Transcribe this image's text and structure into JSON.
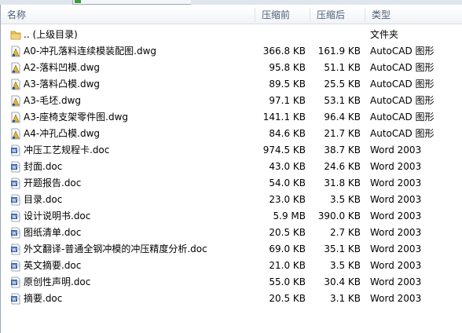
{
  "columns": {
    "name": "名称",
    "original_size": "压缩前",
    "compressed_size": "压缩后",
    "type": "类型"
  },
  "files": [
    {
      "icon": "folder-icon",
      "name": ".. (上级目录)",
      "original": "",
      "compressed": "",
      "type": "文件夹"
    },
    {
      "icon": "autocad-file-icon",
      "name": "A0-冲孔落料连续模装配图.dwg",
      "original": "366.8 KB",
      "compressed": "161.9 KB",
      "type": "AutoCAD 图形"
    },
    {
      "icon": "autocad-file-icon",
      "name": "A2-落料凹模.dwg",
      "original": "95.8 KB",
      "compressed": "51.1 KB",
      "type": "AutoCAD 图形"
    },
    {
      "icon": "autocad-file-icon",
      "name": "A3-落料凸模.dwg",
      "original": "89.5 KB",
      "compressed": "25.5 KB",
      "type": "AutoCAD 图形"
    },
    {
      "icon": "autocad-file-icon",
      "name": "A3-毛坯.dwg",
      "original": "97.1 KB",
      "compressed": "53.1 KB",
      "type": "AutoCAD 图形"
    },
    {
      "icon": "autocad-file-icon",
      "name": "A3-座椅支架零件图.dwg",
      "original": "141.1 KB",
      "compressed": "96.4 KB",
      "type": "AutoCAD 图形"
    },
    {
      "icon": "autocad-file-icon",
      "name": "A4-冲孔凸模.dwg",
      "original": "84.6 KB",
      "compressed": "21.7 KB",
      "type": "AutoCAD 图形"
    },
    {
      "icon": "word-file-icon",
      "name": "冲压工艺规程卡.doc",
      "original": "974.5 KB",
      "compressed": "38.7 KB",
      "type": "Word 2003"
    },
    {
      "icon": "word-file-icon",
      "name": "封面.doc",
      "original": "43.0 KB",
      "compressed": "24.6 KB",
      "type": "Word 2003"
    },
    {
      "icon": "word-file-icon",
      "name": "开题报告.doc",
      "original": "54.0 KB",
      "compressed": "31.8 KB",
      "type": "Word 2003"
    },
    {
      "icon": "word-file-icon",
      "name": "目录.doc",
      "original": "23.0 KB",
      "compressed": "3.5 KB",
      "type": "Word 2003"
    },
    {
      "icon": "word-file-icon",
      "name": "设计说明书.doc",
      "original": "5.9 MB",
      "compressed": "390.0 KB",
      "type": "Word 2003"
    },
    {
      "icon": "word-file-icon",
      "name": "图纸清单.doc",
      "original": "20.5 KB",
      "compressed": "2.7 KB",
      "type": "Word 2003"
    },
    {
      "icon": "word-file-icon",
      "name": "外文翻译-普通全钢冲模的冲压精度分析.doc",
      "original": "69.0 KB",
      "compressed": "35.1 KB",
      "type": "Word 2003"
    },
    {
      "icon": "word-file-icon",
      "name": "英文摘要.doc",
      "original": "21.0 KB",
      "compressed": "3.5 KB",
      "type": "Word 2003"
    },
    {
      "icon": "word-file-icon",
      "name": "原创性声明.doc",
      "original": "55.0 KB",
      "compressed": "30.4 KB",
      "type": "Word 2003"
    },
    {
      "icon": "word-file-icon",
      "name": "摘要.doc",
      "original": "20.5 KB",
      "compressed": "3.1 KB",
      "type": "Word 2003"
    }
  ],
  "colors": {
    "header_text": "#4c607a",
    "folder": "#e8c25a",
    "autocad": "#e0b53a",
    "word": "#2f5fa8"
  }
}
